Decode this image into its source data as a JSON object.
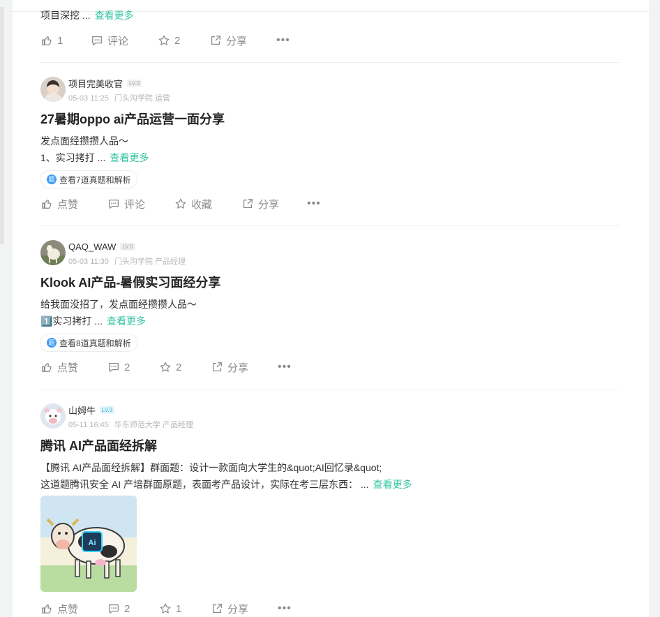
{
  "post0": {
    "snippet": "项目深挖 ...",
    "more": "查看更多",
    "actions": {
      "like": "1",
      "comment": "评论",
      "star": "2",
      "share": "分享"
    }
  },
  "posts": [
    {
      "author": "项目完美收官",
      "level": "LV.0",
      "time": "05-03 11:25",
      "school": "门头沟学院 运营",
      "title": "27暑期oppo ai产品运营一面分享",
      "lines": [
        "发点面经攒攒人品～",
        "1、实习拷打 ..."
      ],
      "more": "查看更多",
      "chip": "查看7道真题和解析",
      "actions": {
        "like": "点赞",
        "comment": "评论",
        "star": "收藏",
        "share": "分享"
      }
    },
    {
      "author": "QAQ_WAW",
      "level": "LV.0",
      "time": "05-03 11:30",
      "school": "门头沟学院 产品经理",
      "title": "Klook AI产品-暑假实习面经分享",
      "lines": [
        "给我面没招了，发点面经攒攒人品～",
        "1️⃣实习拷打 ..."
      ],
      "more": "查看更多",
      "chip": "查看8道真题和解析",
      "actions": {
        "like": "点赞",
        "comment": "2",
        "star": "2",
        "share": "分享"
      }
    },
    {
      "author": "山姆牛",
      "level": "LV.3",
      "time": "05-11 16:45",
      "school": "华东师范大学 产品经理",
      "title": "腾讯 AI产品面经拆解",
      "lines": [
        "【腾讯 AI产品面经拆解】群面题：设计一款面向大学生的&quot;AI回忆录&quot;",
        "这道题腾讯安全 AI 产培群面原题，表面考产品设计，实际在考三层东西： ..."
      ],
      "more": "查看更多",
      "thumb_text": "Ai",
      "actions": {
        "like": "点赞",
        "comment": "2",
        "star": "1",
        "share": "分享"
      }
    }
  ],
  "colors": {
    "accent": "#32c5a2",
    "meta": "#b5b5b5",
    "action": "#8a8a8a"
  }
}
